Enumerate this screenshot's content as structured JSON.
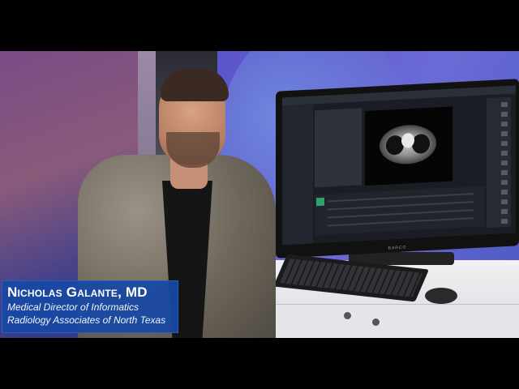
{
  "lower_third": {
    "name": "Nicholas Galante, MD",
    "title": "Medical Director of Informatics",
    "organization": "Radiology Associates of North Texas"
  },
  "monitor": {
    "brand": "BARCO"
  },
  "colors": {
    "lower_third_bg": "#1748a3",
    "background_accent": "#5b59c7"
  }
}
